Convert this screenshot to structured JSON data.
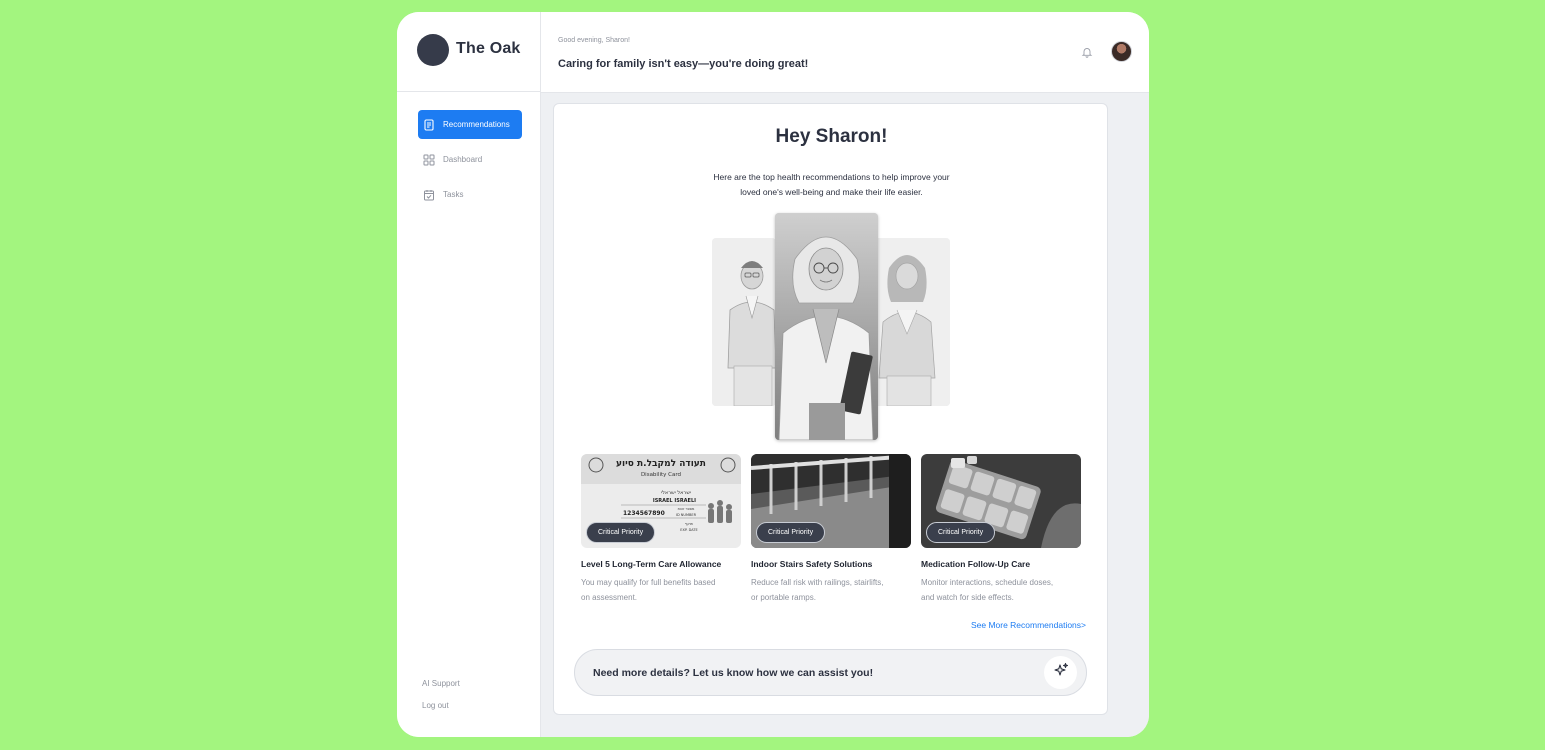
{
  "brand": {
    "name": "The Oak"
  },
  "sidebar": {
    "items": [
      {
        "label": "Recommendations",
        "icon": "document-icon",
        "active": true
      },
      {
        "label": "Dashboard",
        "icon": "grid-icon",
        "active": false
      },
      {
        "label": "Tasks",
        "icon": "calendar-check-icon",
        "active": false
      }
    ],
    "footer": {
      "support": "AI Support",
      "logout": "Log out"
    }
  },
  "header": {
    "greeting_small": "Good evening, Sharon!",
    "greeting_main": "Caring for family isn't easy—you're doing great!",
    "icons": [
      "bell-icon",
      "user-avatar"
    ]
  },
  "main": {
    "title": "Hey Sharon!",
    "intro": "Here are the top health recommendations to help improve your loved one's well-being and make their life easier.",
    "recommendations": [
      {
        "badge": "Critical Priority",
        "title": "Level 5 Long-Term Care Allowance",
        "description": "You may qualify for full benefits based on assessment.",
        "card_text": {
          "heading": "תעודה למקבל.ת סיוע",
          "subheading": "Disability Card",
          "name_he": "ישראל ישראלי",
          "name_en": "ISRAEL ISRAELI",
          "id_number": "1234567890",
          "id_label_he": "מספר זהות",
          "id_label_en": "ID NUMBER",
          "exp_label_he": "תוקף",
          "exp_label_en": "EXP. DATE"
        }
      },
      {
        "badge": "Critical Priority",
        "title": "Indoor Stairs Safety Solutions",
        "description": "Reduce fall risk with railings, stairlifts, or portable ramps."
      },
      {
        "badge": "Critical Priority",
        "title": "Medication Follow-Up Care",
        "description": "Monitor interactions, schedule doses, and watch for side effects."
      }
    ],
    "see_more": "See More Recommendations>",
    "assist_prompt": "Need more details? Let us know how we can assist you!",
    "assist_icon": "sparkle-icon"
  },
  "colors": {
    "background": "#a3f57f",
    "accent": "#1d7cf2",
    "badge": "#3a3f4c",
    "text": "#2c3140",
    "muted": "#8e929c"
  }
}
